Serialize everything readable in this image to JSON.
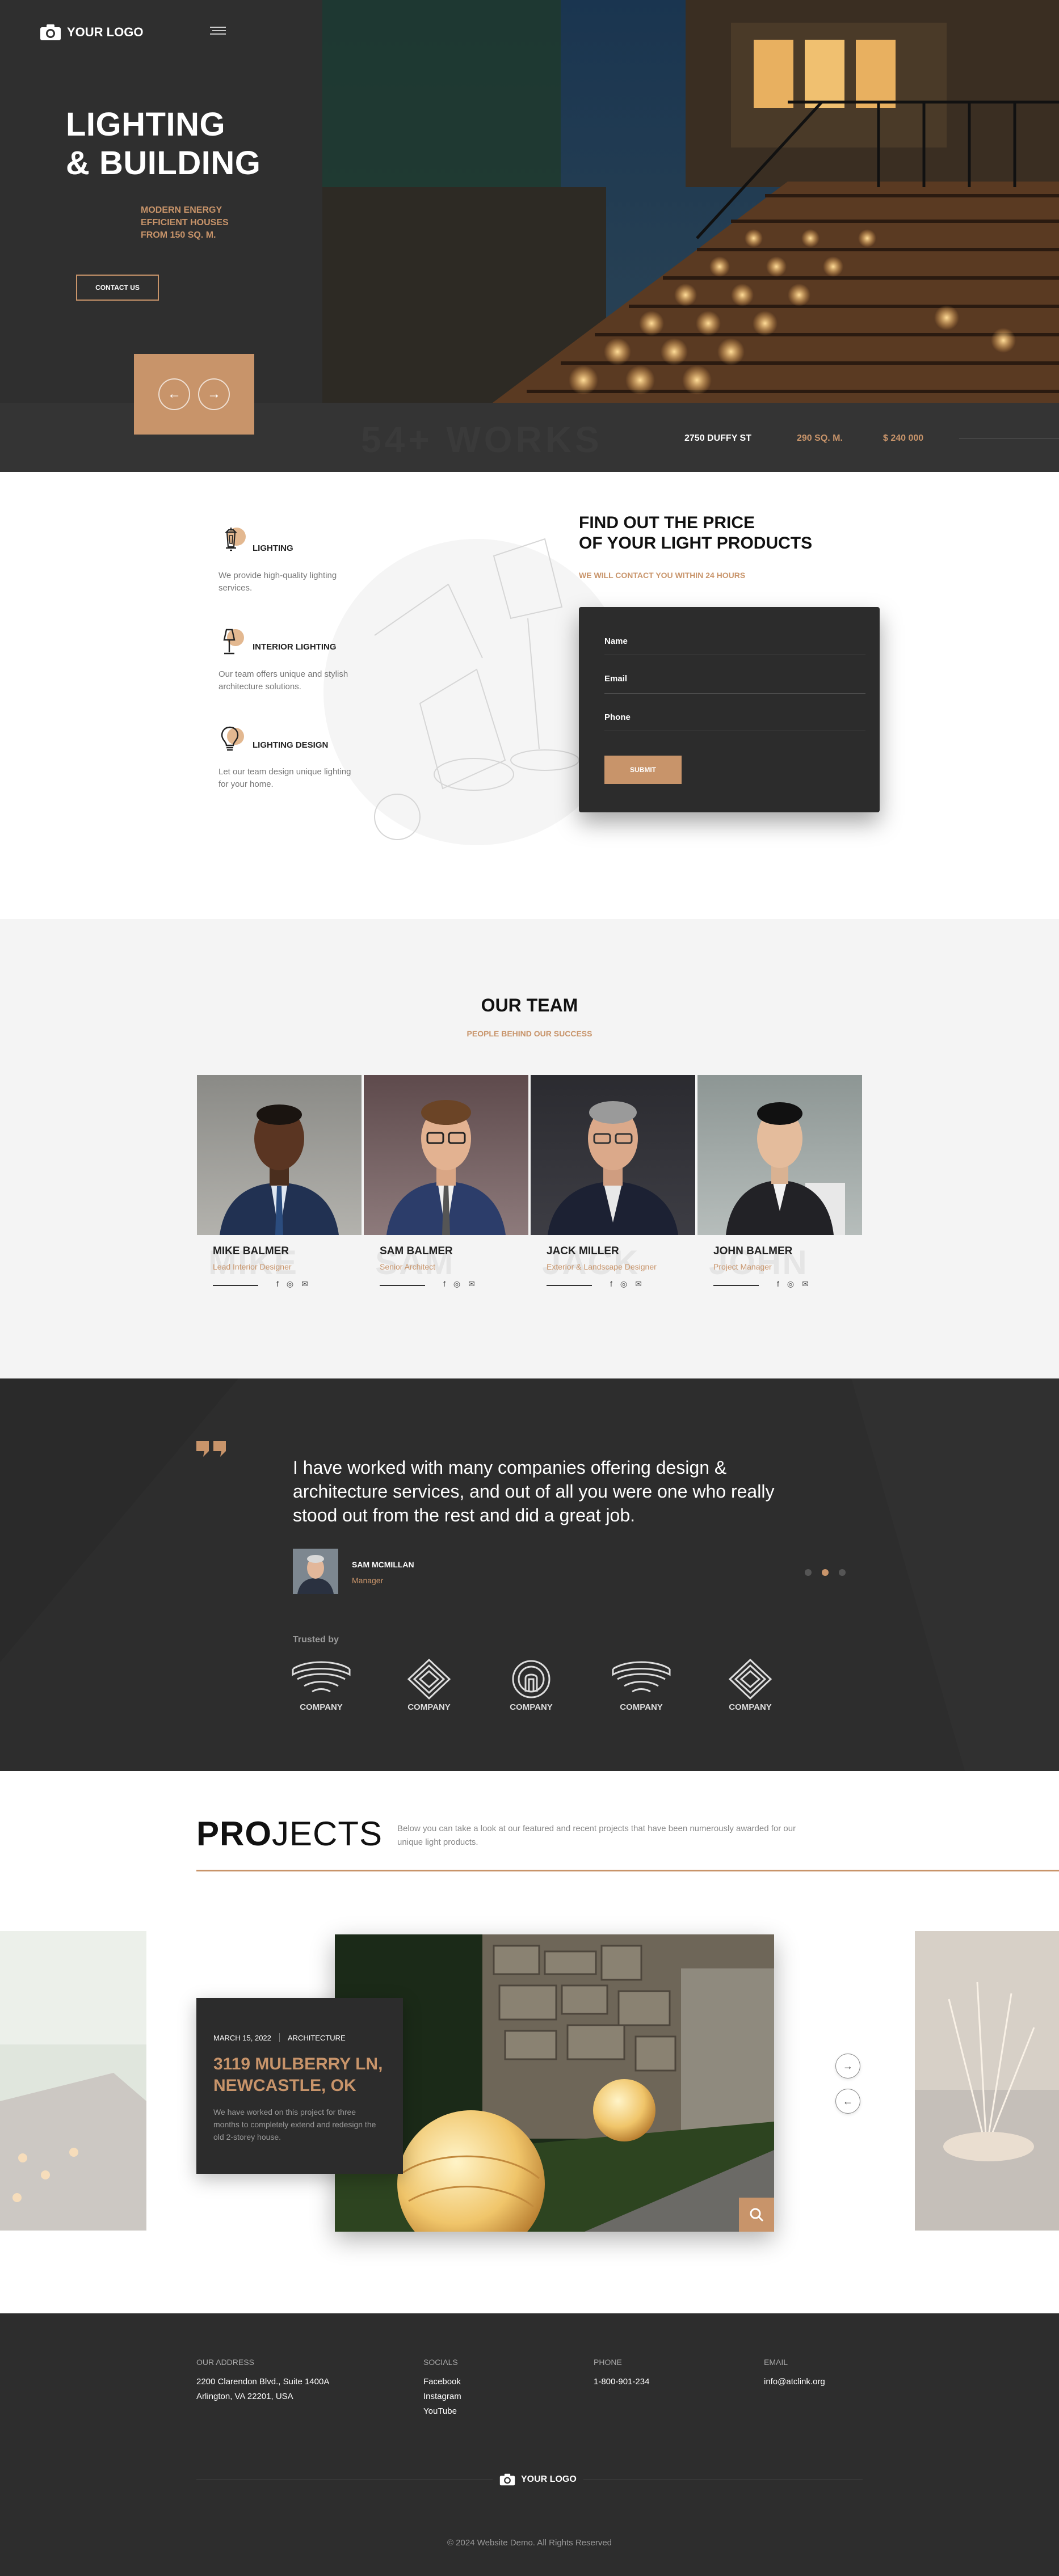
{
  "header": {
    "logo_text": "YOUR LOGO"
  },
  "hero": {
    "title_line1": "LIGHTING",
    "title_line2": "& BUILDING",
    "subtitle_line1": "MODERN ENERGY",
    "subtitle_line2": "EFFICIENT HOUSES",
    "subtitle_line3": "FROM 150 SQ. M.",
    "contact_button": "CONTACT US",
    "works_text": "54+ WORKS",
    "address": "2750 DUFFY ST",
    "area": "290 SQ. M.",
    "price": "$ 240 000"
  },
  "services": [
    {
      "title": "LIGHTING",
      "text": "We provide high-quality lighting services.",
      "icon": "lantern-icon"
    },
    {
      "title": "INTERIOR LIGHTING",
      "text": "Our team offers unique and stylish architecture solutions.",
      "icon": "desk-lamp-icon"
    },
    {
      "title": "LIGHTING DESIGN",
      "text": "Let our team design unique lighting for your home.",
      "icon": "lightbulb-icon"
    }
  ],
  "price_form": {
    "title_line1": "FIND OUT THE PRICE",
    "title_line2": "OF YOUR LIGHT PRODUCTS",
    "subtitle": "WE WILL CONTACT YOU WITHIN 24 HOURS",
    "name_label": "Name",
    "email_label": "Email",
    "phone_label": "Phone",
    "submit_label": "SUBMIT"
  },
  "team": {
    "title": "OUR TEAM",
    "subtitle": "PEOPLE BEHIND OUR SUCCESS",
    "members": [
      {
        "name": "MIKE BALMER",
        "role": "Lead Interior Designer",
        "ghost": "MIKE"
      },
      {
        "name": "SAM BALMER",
        "role": "Senior Architect",
        "ghost": "SAM"
      },
      {
        "name": "JACK MILLER",
        "role": "Exterior & Landscape Designer",
        "ghost": "JACK"
      },
      {
        "name": "JOHN BALMER",
        "role": "Project Manager",
        "ghost": "JOHN"
      }
    ],
    "social_icons": [
      "facebook-icon",
      "instagram-icon",
      "email-icon"
    ]
  },
  "testimonial": {
    "quote": "I have worked with many companies offering design & architecture services, and out of all you were one who really stood out from the rest and did a great job.",
    "author": "SAM MCMILLAN",
    "author_role": "Manager",
    "trusted_label": "Trusted by",
    "companies": [
      "COMPANY",
      "COMPANY",
      "COMPANY",
      "COMPANY",
      "COMPANY"
    ],
    "active_dot": 1
  },
  "projects": {
    "title_bold": "PRO",
    "title_light": "JECTS",
    "description": "Below you can take a look at our featured and recent projects that have been numerously awarded for our unique light products.",
    "featured": {
      "date": "MARCH 15, 2022",
      "category": "ARCHITECTURE",
      "name_line1": "3119 MULBERRY LN,",
      "name_line2": "NEWCASTLE, OK",
      "text": "We have worked on this project for three months to completely extend and redesign the old 2-storey house."
    }
  },
  "footer": {
    "address_head": "OUR ADDRESS",
    "address_line1": "2200 Clarendon Blvd., Suite 1400A",
    "address_line2": "Arlington, VA 22201, USA",
    "socials_head": "SOCIALS",
    "socials": [
      "Facebook",
      "Instagram",
      "YouTube"
    ],
    "phone_head": "PHONE",
    "phone": "1-800-901-234",
    "email_head": "EMAIL",
    "email": "info@atclink.org",
    "logo_text": "YOUR LOGO",
    "copyright": "© 2024 Website Demo. All Rights Reserved"
  },
  "colors": {
    "accent": "#c8946a",
    "dark": "#2d2d2d",
    "light_bg": "#f4f4f4"
  }
}
